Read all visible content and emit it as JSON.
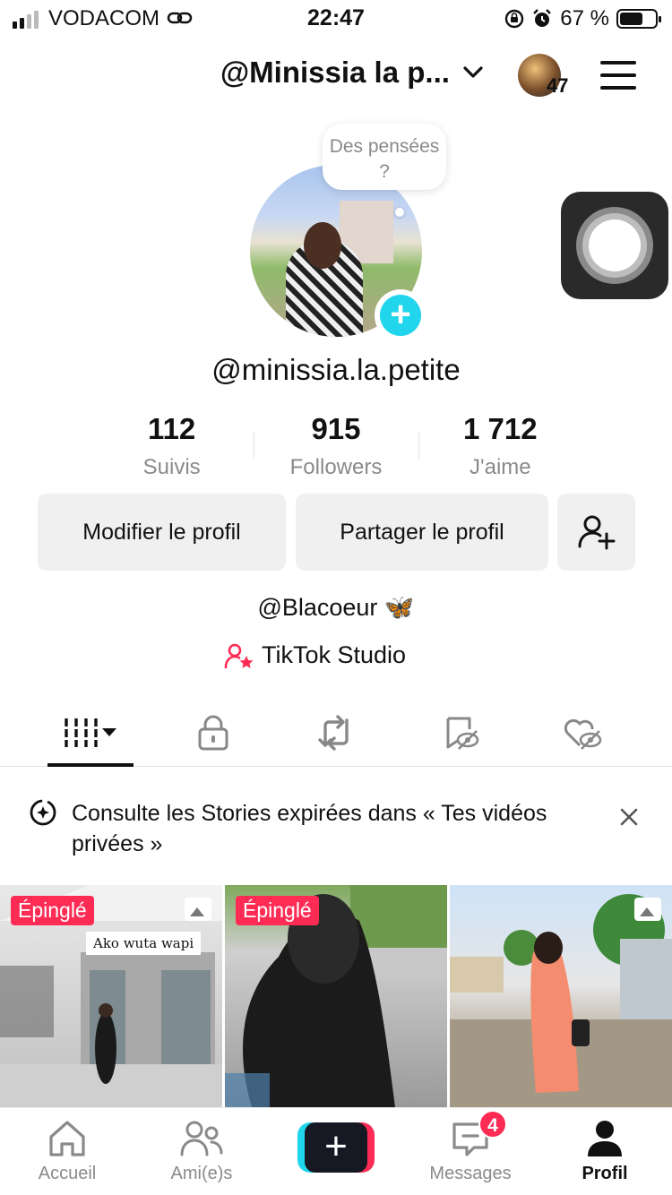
{
  "status_bar": {
    "carrier": "VODACOM",
    "time": "22:47",
    "battery_percent": "67 %",
    "battery_level": 0.67
  },
  "header": {
    "account_name": "@Minissia la p...",
    "avatar_count": "47"
  },
  "profile": {
    "thought_bubble": "Des pensées ?",
    "username": "@minissia.la.petite",
    "stats": [
      {
        "value": "112",
        "label": "Suivis"
      },
      {
        "value": "915",
        "label": "Followers"
      },
      {
        "value": "1 712",
        "label": "J'aime"
      }
    ],
    "edit_button": "Modifier le profil",
    "share_button": "Partager le profil",
    "bio": "@Blacoeur 🦋",
    "studio_link": "TikTok Studio"
  },
  "banner": {
    "text": "Consulte les Stories expirées dans « Tes vidéos privées »"
  },
  "grid": {
    "items": [
      {
        "pinned_label": "Épinglé",
        "caption": "Ako wuta wapi"
      },
      {
        "pinned_label": "Épinglé"
      },
      {}
    ]
  },
  "nav": {
    "items": [
      {
        "label": "Accueil",
        "icon": "home-icon"
      },
      {
        "label": "Ami(e)s",
        "icon": "friends-icon"
      },
      {
        "label": "",
        "icon": "create-icon"
      },
      {
        "label": "Messages",
        "icon": "inbox-icon",
        "badge": "4"
      },
      {
        "label": "Profil",
        "icon": "profile-icon"
      }
    ]
  },
  "colors": {
    "accent_pink": "#fe2c55",
    "accent_cyan": "#20d5ec",
    "muted_text": "#8a8a8a"
  }
}
